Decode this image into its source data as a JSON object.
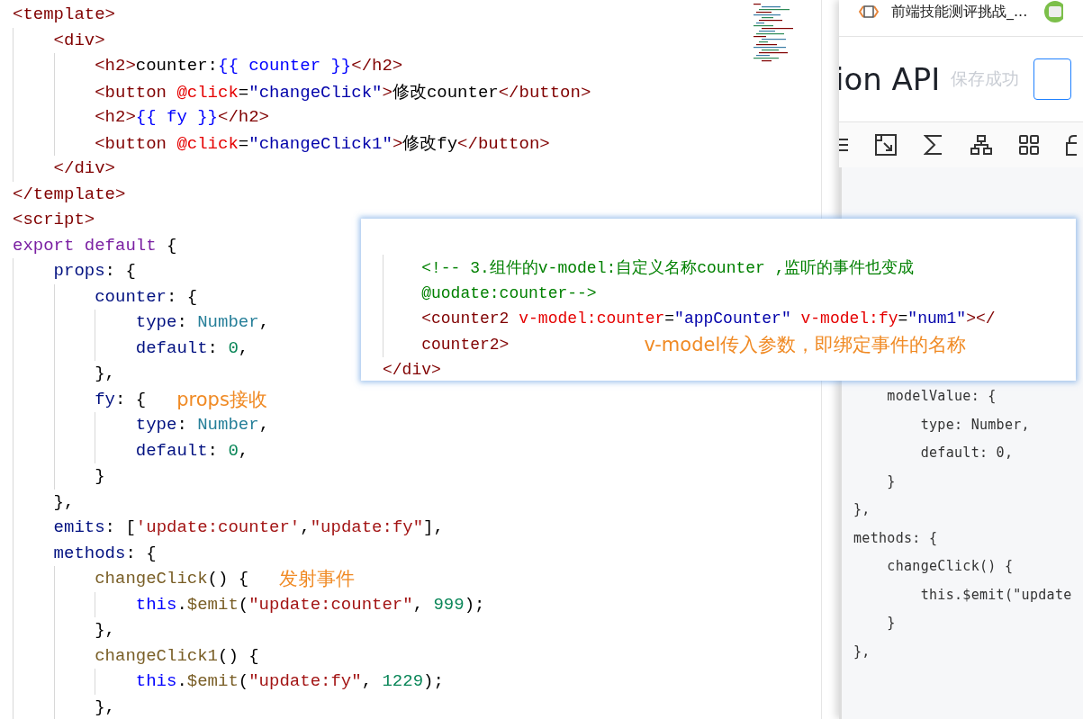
{
  "editor": {
    "lines": [
      {
        "tokens": [
          {
            "kind": "tag",
            "text": "<template>"
          }
        ]
      },
      {
        "tokens": [
          {
            "kind": "tag",
            "text": "    <div>"
          }
        ]
      },
      {
        "tokens": [
          {
            "kind": "tag",
            "text": "        <h2>"
          },
          {
            "kind": "plain",
            "text": "counter:"
          },
          {
            "kind": "keyword",
            "text": "{{ counter }}"
          },
          {
            "kind": "tag",
            "text": "</h2>"
          }
        ]
      },
      {
        "tokens": [
          {
            "kind": "tag",
            "text": "        <button "
          },
          {
            "kind": "attr",
            "text": "@click"
          },
          {
            "kind": "plain",
            "text": "="
          },
          {
            "kind": "value",
            "text": "\"changeClick\""
          },
          {
            "kind": "tag",
            "text": ">"
          },
          {
            "kind": "plain",
            "text": "修改counter"
          },
          {
            "kind": "tag",
            "text": "</button>"
          }
        ]
      },
      {
        "tokens": [
          {
            "kind": "tag",
            "text": "        <h2>"
          },
          {
            "kind": "keyword",
            "text": "{{ fy }}"
          },
          {
            "kind": "tag",
            "text": "</h2>"
          }
        ]
      },
      {
        "tokens": [
          {
            "kind": "tag",
            "text": "        <button "
          },
          {
            "kind": "attr",
            "text": "@click"
          },
          {
            "kind": "plain",
            "text": "="
          },
          {
            "kind": "value",
            "text": "\"changeClick1\""
          },
          {
            "kind": "tag",
            "text": ">"
          },
          {
            "kind": "plain",
            "text": "修改fy"
          },
          {
            "kind": "tag",
            "text": "</button>"
          }
        ]
      },
      {
        "tokens": [
          {
            "kind": "tag",
            "text": "    </div>"
          }
        ]
      },
      {
        "tokens": [
          {
            "kind": "tag",
            "text": "</template>"
          }
        ]
      },
      {
        "tokens": [
          {
            "kind": "tag",
            "text": "<script>"
          }
        ]
      },
      {
        "tokens": [
          {
            "kind": "control",
            "text": "export default"
          },
          {
            "kind": "plain",
            "text": " {"
          }
        ]
      },
      {
        "tokens": [
          {
            "kind": "prop",
            "text": "    props"
          },
          {
            "kind": "plain",
            "text": ": {"
          }
        ]
      },
      {
        "tokens": [
          {
            "kind": "prop",
            "text": "        counter"
          },
          {
            "kind": "plain",
            "text": ": {"
          }
        ]
      },
      {
        "tokens": [
          {
            "kind": "prop",
            "text": "            type"
          },
          {
            "kind": "plain",
            "text": ": "
          },
          {
            "kind": "type",
            "text": "Number"
          },
          {
            "kind": "plain",
            "text": ","
          }
        ]
      },
      {
        "tokens": [
          {
            "kind": "prop",
            "text": "            default"
          },
          {
            "kind": "plain",
            "text": ": "
          },
          {
            "kind": "number",
            "text": "0"
          },
          {
            "kind": "plain",
            "text": ","
          }
        ]
      },
      {
        "tokens": [
          {
            "kind": "plain",
            "text": "        },"
          }
        ]
      },
      {
        "tokens": [
          {
            "kind": "prop",
            "text": "        fy"
          },
          {
            "kind": "plain",
            "text": ": {"
          }
        ],
        "note": "props接收"
      },
      {
        "tokens": [
          {
            "kind": "prop",
            "text": "            type"
          },
          {
            "kind": "plain",
            "text": ": "
          },
          {
            "kind": "type",
            "text": "Number"
          },
          {
            "kind": "plain",
            "text": ","
          }
        ]
      },
      {
        "tokens": [
          {
            "kind": "prop",
            "text": "            default"
          },
          {
            "kind": "plain",
            "text": ": "
          },
          {
            "kind": "number",
            "text": "0"
          },
          {
            "kind": "plain",
            "text": ","
          }
        ]
      },
      {
        "tokens": [
          {
            "kind": "plain",
            "text": "        }"
          }
        ]
      },
      {
        "tokens": [
          {
            "kind": "plain",
            "text": "    },"
          }
        ]
      },
      {
        "tokens": [
          {
            "kind": "prop",
            "text": "    emits"
          },
          {
            "kind": "plain",
            "text": ": ["
          },
          {
            "kind": "string",
            "text": "'update:counter'"
          },
          {
            "kind": "plain",
            "text": ","
          },
          {
            "kind": "string",
            "text": "\"update:fy\""
          },
          {
            "kind": "plain",
            "text": "],"
          }
        ]
      },
      {
        "tokens": [
          {
            "kind": "prop",
            "text": "    methods"
          },
          {
            "kind": "plain",
            "text": ": {"
          }
        ]
      },
      {
        "tokens": [
          {
            "kind": "func",
            "text": "        changeClick"
          },
          {
            "kind": "plain",
            "text": "() {"
          }
        ],
        "note": "发射事件"
      },
      {
        "tokens": [
          {
            "kind": "keyword",
            "text": "            this"
          },
          {
            "kind": "plain",
            "text": "."
          },
          {
            "kind": "func",
            "text": "$emit"
          },
          {
            "kind": "plain",
            "text": "("
          },
          {
            "kind": "string",
            "text": "\"update:counter\""
          },
          {
            "kind": "plain",
            "text": ", "
          },
          {
            "kind": "number",
            "text": "999"
          },
          {
            "kind": "plain",
            "text": ");"
          }
        ]
      },
      {
        "tokens": [
          {
            "kind": "plain",
            "text": "        },"
          }
        ]
      },
      {
        "tokens": [
          {
            "kind": "func",
            "text": "        changeClick1"
          },
          {
            "kind": "plain",
            "text": "() {"
          }
        ]
      },
      {
        "tokens": [
          {
            "kind": "keyword",
            "text": "            this"
          },
          {
            "kind": "plain",
            "text": "."
          },
          {
            "kind": "func",
            "text": "$emit"
          },
          {
            "kind": "plain",
            "text": "("
          },
          {
            "kind": "string",
            "text": "\"update:fy\""
          },
          {
            "kind": "plain",
            "text": ", "
          },
          {
            "kind": "number",
            "text": "1229"
          },
          {
            "kind": "plain",
            "text": ");"
          }
        ]
      },
      {
        "tokens": [
          {
            "kind": "plain",
            "text": "        },"
          }
        ]
      }
    ]
  },
  "popup": {
    "lines": [
      {
        "tokens": [
          {
            "kind": "comment",
            "text": "    <!-- 3.组件的v-model:自定义名称counter ,监听的事件也变成"
          }
        ]
      },
      {
        "tokens": [
          {
            "kind": "comment",
            "text": "    @uodate:counter-->"
          }
        ]
      },
      {
        "tokens": [
          {
            "kind": "tag",
            "text": "    <counter2 "
          },
          {
            "kind": "attr",
            "text": "v-model:counter"
          },
          {
            "kind": "plain",
            "text": "="
          },
          {
            "kind": "value",
            "text": "\"appCounter\""
          },
          {
            "kind": "attr",
            "text": " v-model:fy"
          },
          {
            "kind": "plain",
            "text": "="
          },
          {
            "kind": "value",
            "text": "\"num1\""
          },
          {
            "kind": "tag",
            "text": "></"
          }
        ]
      },
      {
        "tokens": [
          {
            "kind": "tag",
            "text": "    counter2>"
          }
        ],
        "note": "v-model传入参数，即绑定事件的名称"
      },
      {
        "tokens": [
          {
            "kind": "tag",
            "text": "</div>"
          }
        ]
      }
    ]
  },
  "browser_tab": {
    "title": "前端技能测评挑战_..."
  },
  "article": {
    "title": "ion API",
    "save_status": "保存成功"
  },
  "preview_code": {
    "lines": [
      "    modelValue: {",
      "        type: Number,",
      "        default: 0,",
      "    }",
      "},",
      "methods: {",
      "    changeClick() {",
      "        this.$emit(\"update",
      "    }",
      "},"
    ]
  }
}
